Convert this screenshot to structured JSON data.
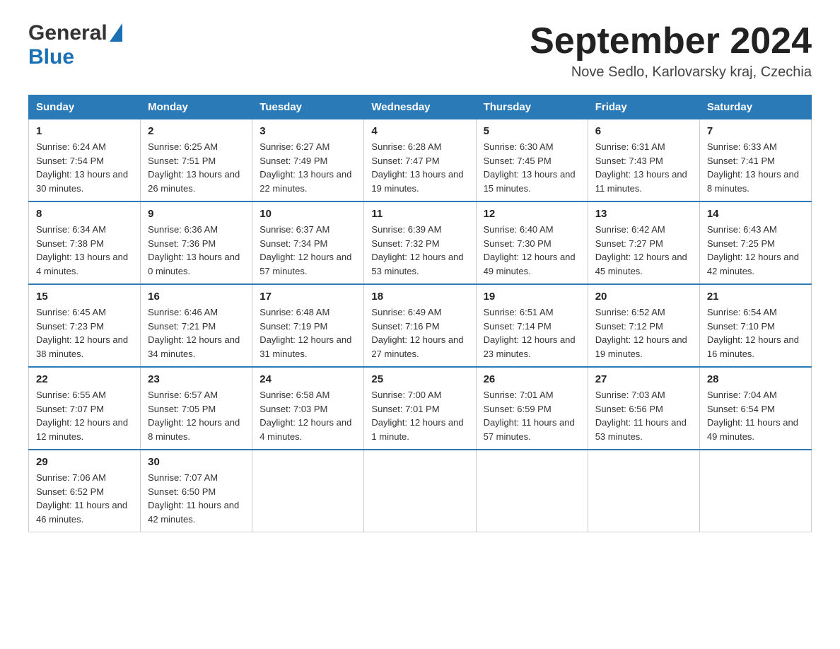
{
  "header": {
    "logo_general": "General",
    "logo_blue": "Blue",
    "month_title": "September 2024",
    "location": "Nove Sedlo, Karlovarsky kraj, Czechia"
  },
  "days_of_week": [
    "Sunday",
    "Monday",
    "Tuesday",
    "Wednesday",
    "Thursday",
    "Friday",
    "Saturday"
  ],
  "weeks": [
    [
      {
        "day": "1",
        "sunrise": "6:24 AM",
        "sunset": "7:54 PM",
        "daylight": "13 hours and 30 minutes."
      },
      {
        "day": "2",
        "sunrise": "6:25 AM",
        "sunset": "7:51 PM",
        "daylight": "13 hours and 26 minutes."
      },
      {
        "day": "3",
        "sunrise": "6:27 AM",
        "sunset": "7:49 PM",
        "daylight": "13 hours and 22 minutes."
      },
      {
        "day": "4",
        "sunrise": "6:28 AM",
        "sunset": "7:47 PM",
        "daylight": "13 hours and 19 minutes."
      },
      {
        "day": "5",
        "sunrise": "6:30 AM",
        "sunset": "7:45 PM",
        "daylight": "13 hours and 15 minutes."
      },
      {
        "day": "6",
        "sunrise": "6:31 AM",
        "sunset": "7:43 PM",
        "daylight": "13 hours and 11 minutes."
      },
      {
        "day": "7",
        "sunrise": "6:33 AM",
        "sunset": "7:41 PM",
        "daylight": "13 hours and 8 minutes."
      }
    ],
    [
      {
        "day": "8",
        "sunrise": "6:34 AM",
        "sunset": "7:38 PM",
        "daylight": "13 hours and 4 minutes."
      },
      {
        "day": "9",
        "sunrise": "6:36 AM",
        "sunset": "7:36 PM",
        "daylight": "13 hours and 0 minutes."
      },
      {
        "day": "10",
        "sunrise": "6:37 AM",
        "sunset": "7:34 PM",
        "daylight": "12 hours and 57 minutes."
      },
      {
        "day": "11",
        "sunrise": "6:39 AM",
        "sunset": "7:32 PM",
        "daylight": "12 hours and 53 minutes."
      },
      {
        "day": "12",
        "sunrise": "6:40 AM",
        "sunset": "7:30 PM",
        "daylight": "12 hours and 49 minutes."
      },
      {
        "day": "13",
        "sunrise": "6:42 AM",
        "sunset": "7:27 PM",
        "daylight": "12 hours and 45 minutes."
      },
      {
        "day": "14",
        "sunrise": "6:43 AM",
        "sunset": "7:25 PM",
        "daylight": "12 hours and 42 minutes."
      }
    ],
    [
      {
        "day": "15",
        "sunrise": "6:45 AM",
        "sunset": "7:23 PM",
        "daylight": "12 hours and 38 minutes."
      },
      {
        "day": "16",
        "sunrise": "6:46 AM",
        "sunset": "7:21 PM",
        "daylight": "12 hours and 34 minutes."
      },
      {
        "day": "17",
        "sunrise": "6:48 AM",
        "sunset": "7:19 PM",
        "daylight": "12 hours and 31 minutes."
      },
      {
        "day": "18",
        "sunrise": "6:49 AM",
        "sunset": "7:16 PM",
        "daylight": "12 hours and 27 minutes."
      },
      {
        "day": "19",
        "sunrise": "6:51 AM",
        "sunset": "7:14 PM",
        "daylight": "12 hours and 23 minutes."
      },
      {
        "day": "20",
        "sunrise": "6:52 AM",
        "sunset": "7:12 PM",
        "daylight": "12 hours and 19 minutes."
      },
      {
        "day": "21",
        "sunrise": "6:54 AM",
        "sunset": "7:10 PM",
        "daylight": "12 hours and 16 minutes."
      }
    ],
    [
      {
        "day": "22",
        "sunrise": "6:55 AM",
        "sunset": "7:07 PM",
        "daylight": "12 hours and 12 minutes."
      },
      {
        "day": "23",
        "sunrise": "6:57 AM",
        "sunset": "7:05 PM",
        "daylight": "12 hours and 8 minutes."
      },
      {
        "day": "24",
        "sunrise": "6:58 AM",
        "sunset": "7:03 PM",
        "daylight": "12 hours and 4 minutes."
      },
      {
        "day": "25",
        "sunrise": "7:00 AM",
        "sunset": "7:01 PM",
        "daylight": "12 hours and 1 minute."
      },
      {
        "day": "26",
        "sunrise": "7:01 AM",
        "sunset": "6:59 PM",
        "daylight": "11 hours and 57 minutes."
      },
      {
        "day": "27",
        "sunrise": "7:03 AM",
        "sunset": "6:56 PM",
        "daylight": "11 hours and 53 minutes."
      },
      {
        "day": "28",
        "sunrise": "7:04 AM",
        "sunset": "6:54 PM",
        "daylight": "11 hours and 49 minutes."
      }
    ],
    [
      {
        "day": "29",
        "sunrise": "7:06 AM",
        "sunset": "6:52 PM",
        "daylight": "11 hours and 46 minutes."
      },
      {
        "day": "30",
        "sunrise": "7:07 AM",
        "sunset": "6:50 PM",
        "daylight": "11 hours and 42 minutes."
      },
      null,
      null,
      null,
      null,
      null
    ]
  ],
  "labels": {
    "sunrise": "Sunrise:",
    "sunset": "Sunset:",
    "daylight": "Daylight:"
  }
}
